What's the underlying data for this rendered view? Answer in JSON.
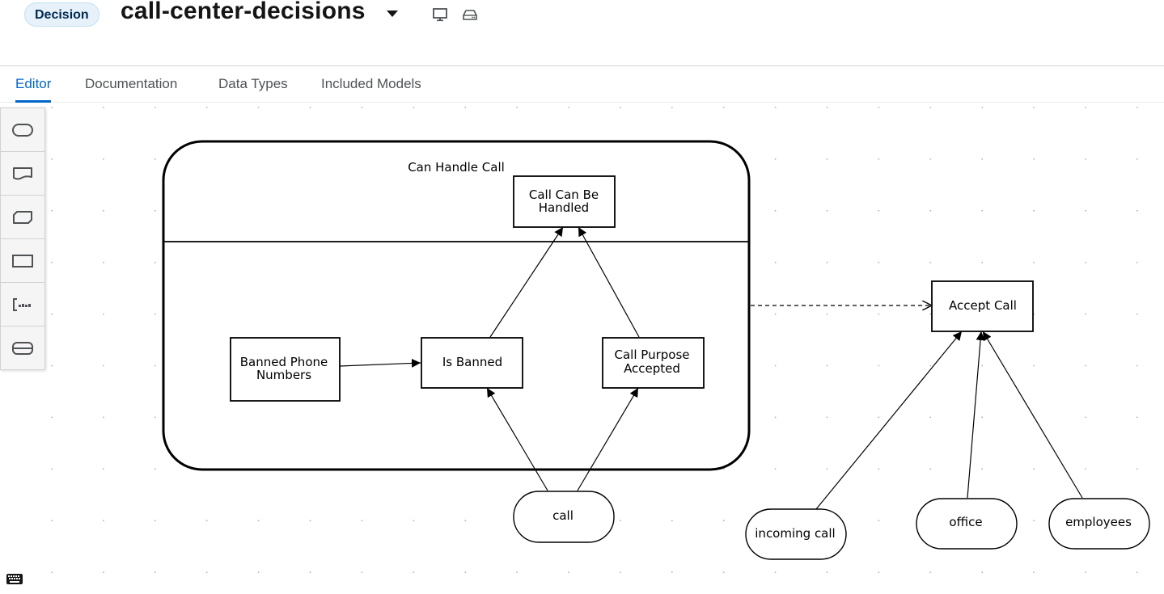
{
  "header": {
    "badge": "Decision",
    "title": "call-center-decisions",
    "icons": [
      "caret-down-icon",
      "desktop-icon",
      "hard-drive-icon"
    ]
  },
  "tabs": [
    {
      "label": "Editor",
      "active": true
    },
    {
      "label": "Documentation",
      "active": false
    },
    {
      "label": "Data Types",
      "active": false
    },
    {
      "label": "Included Models",
      "active": false
    }
  ],
  "palette": {
    "items": [
      {
        "icon": "input-data-icon",
        "label": "Input Data"
      },
      {
        "icon": "knowledge-source-icon",
        "label": "Knowledge Source"
      },
      {
        "icon": "business-knowledge-model-icon",
        "label": "Business Knowledge Model"
      },
      {
        "icon": "decision-icon",
        "label": "Decision"
      },
      {
        "icon": "text-annotation-icon",
        "label": "Text Annotation"
      },
      {
        "icon": "decision-service-icon",
        "label": "Decision Service"
      }
    ]
  },
  "diagram": {
    "decision_service": {
      "label": "Can Handle Call"
    },
    "nodes": {
      "call_can_be_handled": {
        "type": "decision",
        "lines": [
          "Call Can Be",
          "Handled"
        ]
      },
      "banned_phone_numbers": {
        "type": "decision",
        "lines": [
          "Banned Phone",
          "Numbers"
        ]
      },
      "is_banned": {
        "type": "decision",
        "lines": [
          "Is Banned"
        ]
      },
      "call_purpose_accepted": {
        "type": "decision",
        "lines": [
          "Call Purpose",
          "Accepted"
        ]
      },
      "accept_call": {
        "type": "decision",
        "lines": [
          "Accept Call"
        ]
      },
      "call": {
        "type": "input-data",
        "lines": [
          "call"
        ]
      },
      "incoming_call": {
        "type": "input-data",
        "lines": [
          "incoming call"
        ]
      },
      "office": {
        "type": "input-data",
        "lines": [
          "office"
        ]
      },
      "employees": {
        "type": "input-data",
        "lines": [
          "employees"
        ]
      }
    },
    "edges": [
      {
        "from": "banned_phone_numbers",
        "to": "is_banned",
        "kind": "information-requirement"
      },
      {
        "from": "is_banned",
        "to": "call_can_be_handled",
        "kind": "information-requirement"
      },
      {
        "from": "call_purpose_accepted",
        "to": "call_can_be_handled",
        "kind": "information-requirement"
      },
      {
        "from": "call",
        "to": "is_banned",
        "kind": "information-requirement"
      },
      {
        "from": "call",
        "to": "call_purpose_accepted",
        "kind": "information-requirement"
      },
      {
        "from": "decision_service",
        "to": "accept_call",
        "kind": "knowledge-requirement"
      },
      {
        "from": "incoming_call",
        "to": "accept_call",
        "kind": "information-requirement"
      },
      {
        "from": "office",
        "to": "accept_call",
        "kind": "information-requirement"
      },
      {
        "from": "employees",
        "to": "accept_call",
        "kind": "information-requirement"
      }
    ]
  },
  "footer": {
    "keyboard_icon": "keyboard-icon"
  },
  "colors": {
    "accent": "#0066cc",
    "badge_bg": "#e7f1fa",
    "badge_border": "#bee1f4",
    "badge_text": "#002952"
  }
}
